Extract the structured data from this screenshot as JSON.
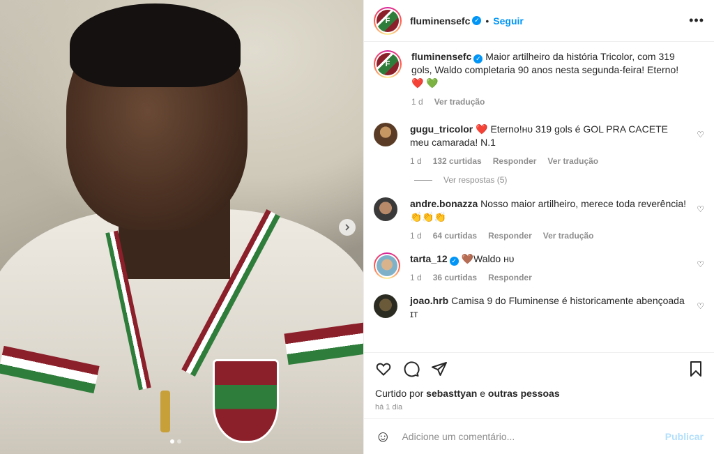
{
  "header": {
    "username": "fluminensefc",
    "follow_label": "Seguir",
    "more_label": "•••"
  },
  "caption": {
    "username": "fluminensefc",
    "text": "Maior artilheiro da história Tricolor, com 319 gols, Waldo completaria 90 anos nesta segunda-feira! Eterno! ❤️ 💚",
    "age": "1 d",
    "translate_label": "Ver tradução"
  },
  "comments": [
    {
      "username": "gugu_tricolor",
      "text": "❤️ Eterno!ʜᴜ 319 gols é GOL PRA CACETE meu camarada! N.1",
      "age": "1 d",
      "likes": "132 curtidas",
      "reply_label": "Responder",
      "translate_label": "Ver tradução",
      "replies_label": "Ver respostas (5)"
    },
    {
      "username": "andre.bonazza",
      "text": "Nosso maior artilheiro, merece toda reverência! 👏👏👏",
      "age": "1 d",
      "likes": "64 curtidas",
      "reply_label": "Responder",
      "translate_label": "Ver tradução"
    },
    {
      "username": "tarta_12",
      "text": "🤎Waldo ʜᴜ",
      "age": "1 d",
      "likes": "36 curtidas",
      "reply_label": "Responder"
    },
    {
      "username": "joao.hrb",
      "text": "Camisa 9 do Fluminense é historicamente abençoada ɪᴛ"
    }
  ],
  "footer": {
    "liked_prefix": "Curtido por",
    "liked_user": "sebasttyan",
    "liked_joiner": "e",
    "liked_others": "outras pessoas",
    "posted_ago": "há 1 dia"
  },
  "add_comment": {
    "placeholder": "Adicione um comentário...",
    "publish_label": "Publicar"
  },
  "colors": {
    "accent_blue": "#0095f6",
    "heart_red": "#ed4956",
    "crest_green": "#2f7d3b",
    "crest_maroon": "#8b1f2a"
  },
  "icons": [
    "heart-icon",
    "comment-icon",
    "share-icon",
    "bookmark-icon",
    "emoji-icon",
    "verified-icon",
    "chevron-right-icon"
  ],
  "carousel": {
    "current": 1,
    "total": 2
  }
}
